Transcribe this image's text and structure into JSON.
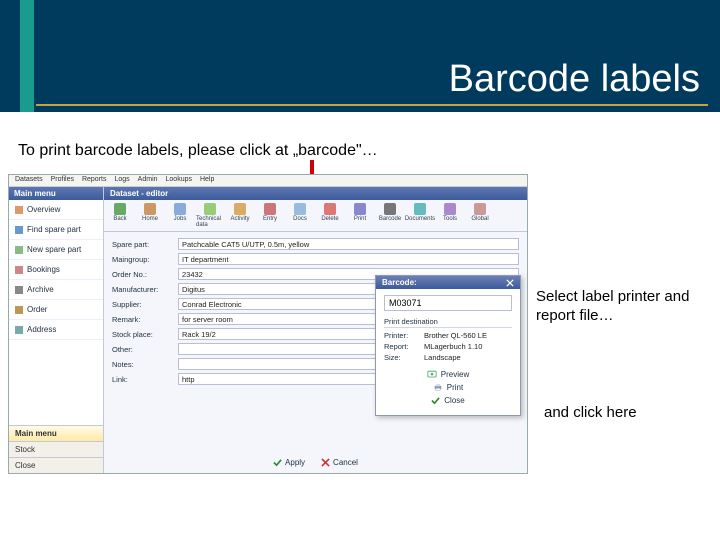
{
  "title": "Barcode labels",
  "instructions": {
    "step1": "To print barcode labels, please click at „barcode\"…",
    "step2": "Select label printer and report file…",
    "step3": "and click here"
  },
  "menubar": [
    "Datasets",
    "Profiles",
    "Reports",
    "Logs",
    "Admin",
    "Lookups",
    "Help"
  ],
  "sidebar": {
    "header": "Main menu",
    "items": [
      "Overview",
      "Find spare part",
      "New spare part",
      "Bookings",
      "Archive",
      "Order",
      "Address"
    ],
    "bottom": [
      "Main menu",
      "Stock",
      "Close"
    ]
  },
  "editor": {
    "header": "Dataset - editor",
    "toolbar": [
      "Back",
      "Home",
      "Jobs",
      "Technical data",
      "Activity",
      "Entry",
      "Docs",
      "Delete",
      "Print",
      "Barcode",
      "Documents",
      "Tools",
      "Global"
    ],
    "fields": [
      {
        "label": "Spare part:",
        "value": "Patchcable CAT5 U/UTP, 0.5m, yellow"
      },
      {
        "label": "Maingroup:",
        "value": "IT department"
      },
      {
        "label": "Order No.:",
        "value": "23432"
      },
      {
        "label": "Manufacturer:",
        "value": "Digitus"
      },
      {
        "label": "Supplier:",
        "value": "Conrad Electronic"
      },
      {
        "label": "Remark:",
        "value": "for server room"
      },
      {
        "label": "Stock place:",
        "value": "Rack 19/2"
      },
      {
        "label": "Other:",
        "value": ""
      },
      {
        "label": "Notes:",
        "value": ""
      },
      {
        "label": "Link:",
        "value": "http"
      }
    ],
    "buttons": {
      "apply": "Apply",
      "cancel": "Cancel"
    }
  },
  "popup": {
    "title": "Barcode:",
    "value": "M03071",
    "section": "Print destination",
    "rows": [
      {
        "label": "Printer:",
        "value": "Brother QL-560 LE"
      },
      {
        "label": "Report:",
        "value": "MLagerbuch 1.10"
      },
      {
        "label": "Size:",
        "value": "Landscape"
      }
    ],
    "buttons": {
      "preview": "Preview",
      "print": "Print",
      "close": "Close"
    }
  }
}
